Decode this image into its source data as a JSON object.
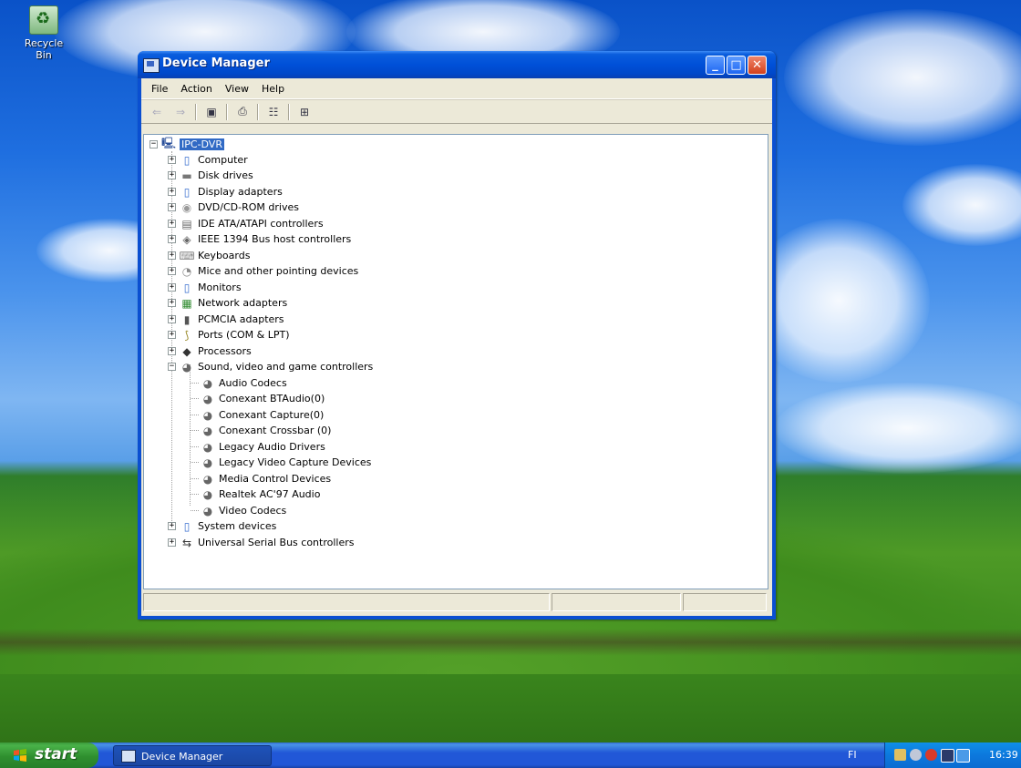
{
  "desktop": {
    "recycle_bin_label": "Recycle Bin"
  },
  "window": {
    "title": "Device Manager",
    "menu": [
      "File",
      "Action",
      "View",
      "Help"
    ]
  },
  "tree": {
    "root": "IPC-DVR",
    "items": [
      {
        "label": "Computer",
        "icon": "computer-icon",
        "expanded": false
      },
      {
        "label": "Disk drives",
        "icon": "disk-drive-icon",
        "expanded": false
      },
      {
        "label": "Display adapters",
        "icon": "display-adapter-icon",
        "expanded": false
      },
      {
        "label": "DVD/CD-ROM drives",
        "icon": "dvd-drive-icon",
        "expanded": false
      },
      {
        "label": "IDE ATA/ATAPI controllers",
        "icon": "ide-controller-icon",
        "expanded": false
      },
      {
        "label": "IEEE 1394 Bus host controllers",
        "icon": "firewire-icon",
        "expanded": false
      },
      {
        "label": "Keyboards",
        "icon": "keyboard-icon",
        "expanded": false
      },
      {
        "label": "Mice and other pointing devices",
        "icon": "mouse-icon",
        "expanded": false
      },
      {
        "label": "Monitors",
        "icon": "monitor-icon",
        "expanded": false
      },
      {
        "label": "Network adapters",
        "icon": "network-adapter-icon",
        "expanded": false
      },
      {
        "label": "PCMCIA adapters",
        "icon": "pcmcia-icon",
        "expanded": false
      },
      {
        "label": "Ports (COM & LPT)",
        "icon": "port-icon",
        "expanded": false
      },
      {
        "label": "Processors",
        "icon": "processor-icon",
        "expanded": false
      },
      {
        "label": "Sound, video and game controllers",
        "icon": "speaker-icon",
        "expanded": true,
        "children": [
          "Audio Codecs",
          "Conexant BTAudio(0)",
          "Conexant Capture(0)",
          "Conexant Crossbar (0)",
          "Legacy Audio Drivers",
          "Legacy Video Capture Devices",
          "Media Control Devices",
          "Realtek AC'97 Audio",
          "Video Codecs"
        ]
      },
      {
        "label": "System devices",
        "icon": "system-device-icon",
        "expanded": false
      },
      {
        "label": "Universal Serial Bus controllers",
        "icon": "usb-icon",
        "expanded": false
      }
    ]
  },
  "taskbar": {
    "start_label": "start",
    "task_label": "Device Manager",
    "language": "FI",
    "clock": "16:39"
  }
}
